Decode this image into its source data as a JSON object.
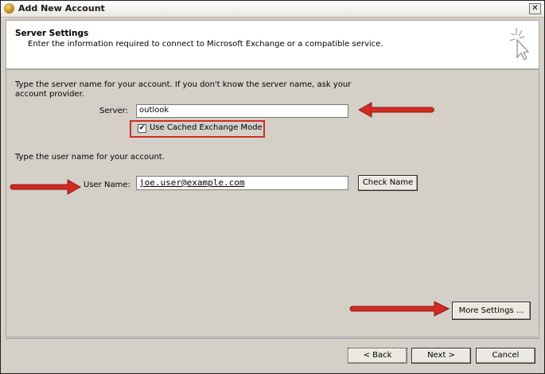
{
  "window": {
    "title": "Add New Account",
    "close_label": "✕"
  },
  "header": {
    "heading": "Server Settings",
    "subheading": "Enter the information required to connect to Microsoft Exchange or a compatible service."
  },
  "server_section": {
    "instruction_line1": "Type the server name for your account. If you don't know the server name, ask your",
    "instruction_line2": "account provider.",
    "server_label": "Server:",
    "server_value": "outlook",
    "cached_mode_label": "Use Cached Exchange Mode",
    "cached_mode_checked": true
  },
  "user_section": {
    "instruction": "Type the user name for your account.",
    "username_label": "User Name:",
    "username_value": "joe.user@example.com",
    "check_name_label": "Check Name"
  },
  "more_settings_label": "More Settings ...",
  "footer": {
    "back_label": "< Back",
    "next_label": "Next >",
    "cancel_label": "Cancel"
  },
  "annotation_color": "#d22a22"
}
